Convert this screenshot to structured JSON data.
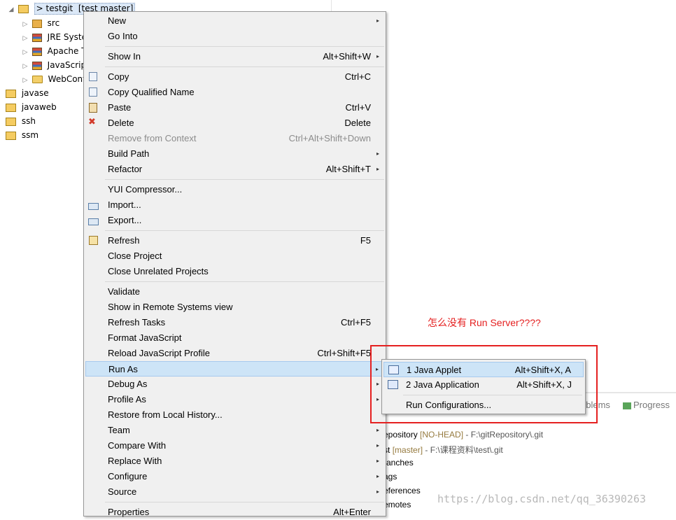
{
  "tree": {
    "root": {
      "label": "> testgit",
      "branch": "[test master]"
    },
    "children": [
      "src",
      "JRE Syste",
      "Apache T",
      "JavaScrip",
      "WebCont"
    ],
    "projects": [
      "javase",
      "javaweb",
      "ssh",
      "ssm"
    ]
  },
  "menu": {
    "items": [
      {
        "label": "New",
        "shortcut": "",
        "submenu": true
      },
      {
        "label": "Go Into",
        "shortcut": ""
      },
      {
        "label": "Show In",
        "shortcut": "Alt+Shift+W",
        "submenu": true
      },
      {
        "label": "Copy",
        "shortcut": "Ctrl+C",
        "icon": "copy-icon"
      },
      {
        "label": "Copy Qualified Name",
        "shortcut": "",
        "icon": "copy-qualified-icon"
      },
      {
        "label": "Paste",
        "shortcut": "Ctrl+V",
        "icon": "paste-icon"
      },
      {
        "label": "Delete",
        "shortcut": "Delete",
        "icon": "delete-icon"
      },
      {
        "label": "Remove from Context",
        "shortcut": "Ctrl+Alt+Shift+Down",
        "disabled": true
      },
      {
        "label": "Build Path",
        "shortcut": "",
        "submenu": true
      },
      {
        "label": "Refactor",
        "shortcut": "Alt+Shift+T",
        "submenu": true
      },
      {
        "label": "YUI Compressor...",
        "shortcut": ""
      },
      {
        "label": "Import...",
        "shortcut": "",
        "icon": "import-icon"
      },
      {
        "label": "Export...",
        "shortcut": "",
        "icon": "export-icon"
      },
      {
        "label": "Refresh",
        "shortcut": "F5",
        "icon": "refresh-icon"
      },
      {
        "label": "Close Project",
        "shortcut": ""
      },
      {
        "label": "Close Unrelated Projects",
        "shortcut": ""
      },
      {
        "label": "Validate",
        "shortcut": ""
      },
      {
        "label": "Show in Remote Systems view",
        "shortcut": ""
      },
      {
        "label": "Refresh Tasks",
        "shortcut": "Ctrl+F5"
      },
      {
        "label": "Format JavaScript",
        "shortcut": ""
      },
      {
        "label": "Reload JavaScript Profile",
        "shortcut": "Ctrl+Shift+F5"
      },
      {
        "label": "Run As",
        "shortcut": "",
        "submenu": true,
        "hot": true
      },
      {
        "label": "Debug As",
        "shortcut": "",
        "submenu": true
      },
      {
        "label": "Profile As",
        "shortcut": "",
        "submenu": true
      },
      {
        "label": "Restore from Local History...",
        "shortcut": ""
      },
      {
        "label": "Team",
        "shortcut": "",
        "submenu": true
      },
      {
        "label": "Compare With",
        "shortcut": "",
        "submenu": true
      },
      {
        "label": "Replace With",
        "shortcut": "",
        "submenu": true
      },
      {
        "label": "Configure",
        "shortcut": "",
        "submenu": true
      },
      {
        "label": "Source",
        "shortcut": "",
        "submenu": true
      },
      {
        "label": "Properties",
        "shortcut": "Alt+Enter"
      }
    ],
    "submenu_arrow": "▸"
  },
  "run_as": {
    "items": [
      {
        "label": "1 Java Applet",
        "shortcut": "Alt+Shift+X, A"
      },
      {
        "label": "2 Java Application",
        "shortcut": "Alt+Shift+X, J"
      },
      {
        "label": "Run Configurations...",
        "shortcut": ""
      }
    ]
  },
  "annotation": "怎么没有 Run Server????",
  "tabs": {
    "problems": "oblems",
    "progress": "Progress"
  },
  "git": {
    "lines": [
      {
        "a": "epository",
        "b": "[NO-HEAD]",
        "c": " - F:\\gitRepository\\.git"
      },
      {
        "a": "st",
        "b": "[master]",
        "c": " - F:\\课程资料\\test\\.git"
      },
      {
        "a": "ranches",
        "b": "",
        "c": ""
      },
      {
        "a": "ags",
        "b": "",
        "c": ""
      },
      {
        "a": "eferences",
        "b": "",
        "c": ""
      },
      {
        "a": "emotes",
        "b": "",
        "c": ""
      }
    ]
  },
  "watermark": "https://blog.csdn.net/qq_36390263",
  "colors": {
    "menu_bg": "#f0f0f0",
    "highlight": "#cde4f7",
    "annotation": "#e52020"
  }
}
